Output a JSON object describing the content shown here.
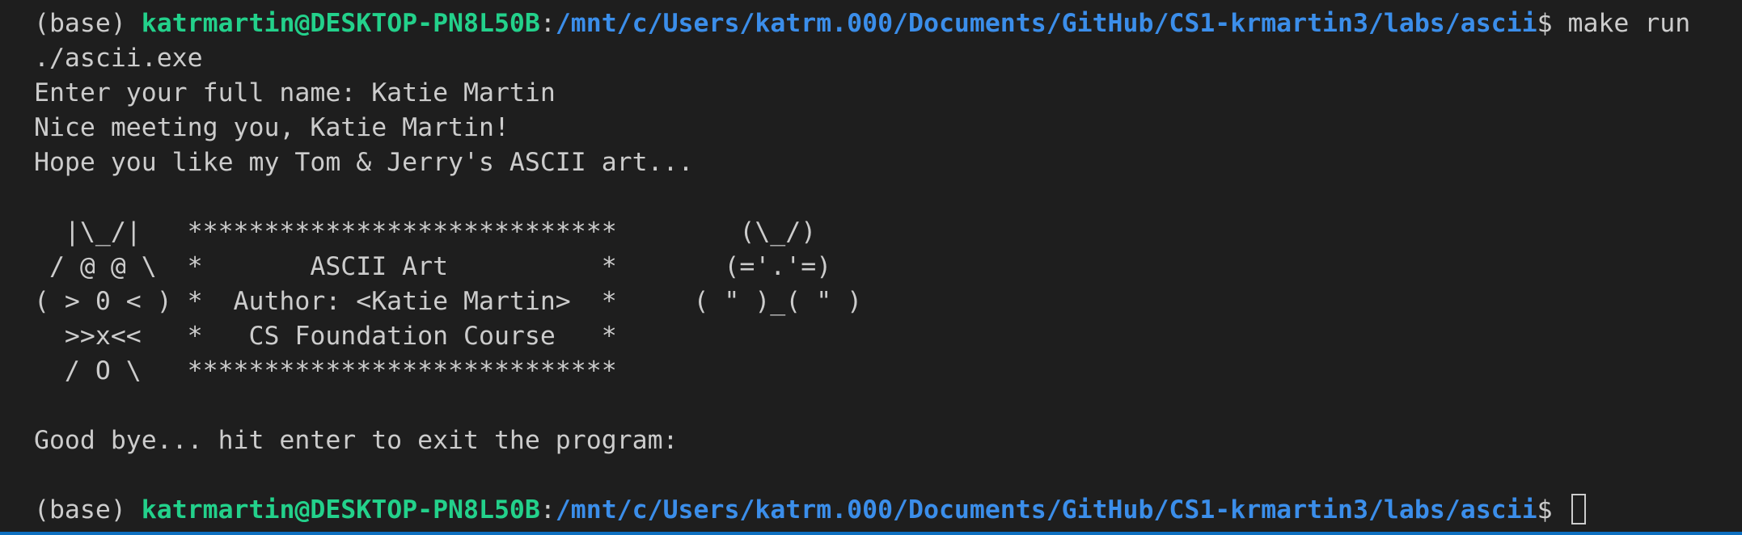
{
  "terminal": {
    "prompt1": {
      "env": "(base) ",
      "user_host": "katrmartin@DESKTOP-PN8L50B",
      "colon": ":",
      "path": "/mnt/c/Users/katrm.000/Documents/GitHub/CS1-krmartin3/labs/ascii",
      "symbol": "$ ",
      "command": "make run"
    },
    "output": [
      "./ascii.exe",
      "Enter your full name: Katie Martin",
      "Nice meeting you, Katie Martin!",
      "Hope you like my Tom & Jerry's ASCII art...",
      "",
      "  |\\_/|   ****************************        (\\_/)",
      " / @ @ \\  *       ASCII Art          *       (='.'=)",
      "( > 0 < ) *  Author: <Katie Martin>  *     ( \" )_( \" )",
      "  >>x<<   *   CS Foundation Course   *",
      "  / O \\   ****************************",
      "",
      "Good bye... hit enter to exit the program:",
      ""
    ],
    "prompt2": {
      "env": "(base) ",
      "user_host": "katrmartin@DESKTOP-PN8L50B",
      "colon": ":",
      "path": "/mnt/c/Users/katrm.000/Documents/GitHub/CS1-krmartin3/labs/ascii",
      "symbol": "$ "
    }
  },
  "colors": {
    "background": "#1e1e1e",
    "text": "#cccccc",
    "user_host": "#23d18b",
    "path": "#3b8eea",
    "focus_bar": "#0e70c0"
  }
}
